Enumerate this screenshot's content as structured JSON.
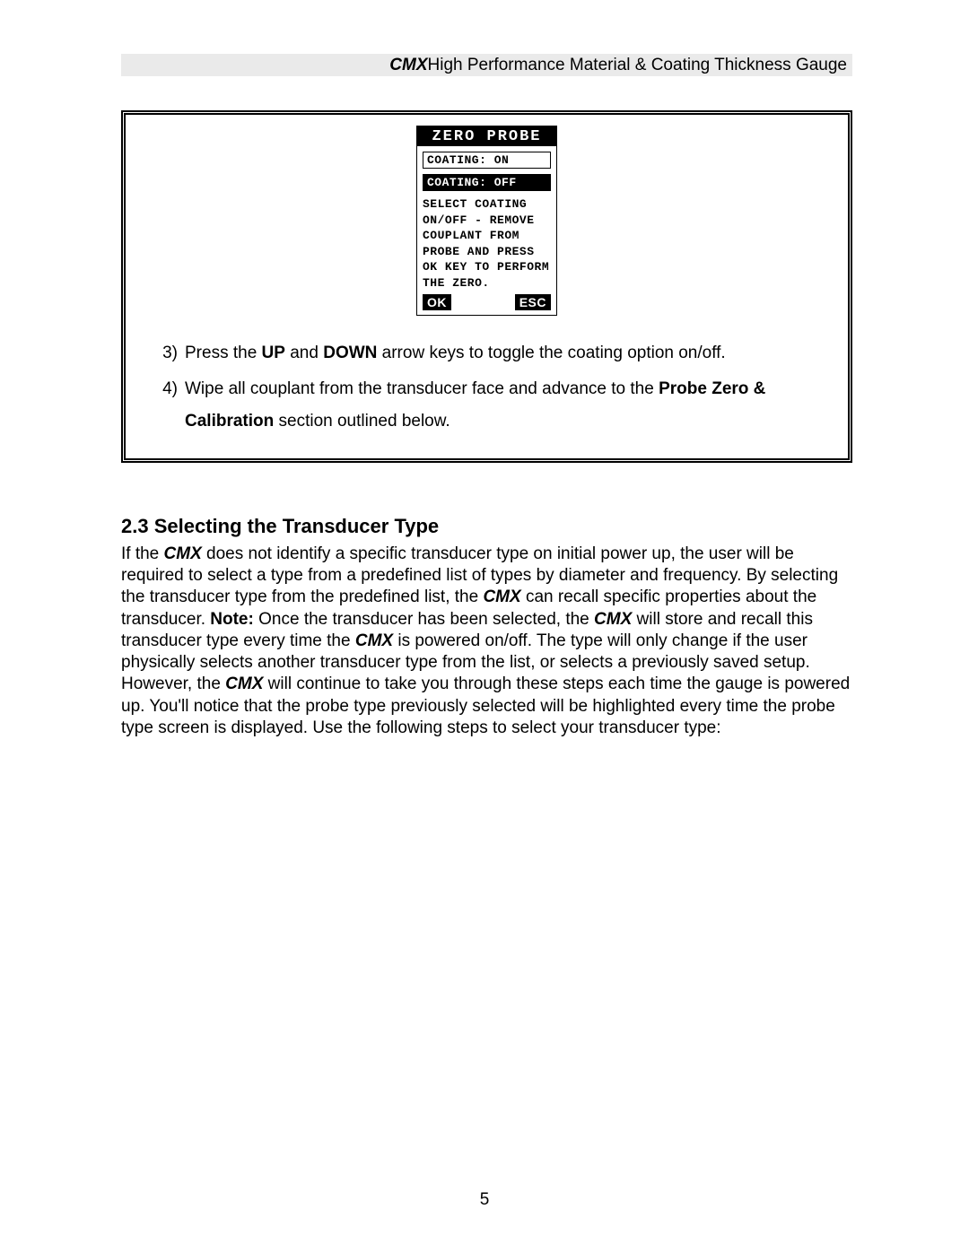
{
  "header": {
    "brand": "CMX",
    "tail": " High Performance Material & Coating  Thickness Gauge"
  },
  "lcd": {
    "title": "ZERO PROBE",
    "opt_on": "COATING:  ON",
    "opt_off": "COATING:  OFF",
    "msg_l1": "SELECT COATING",
    "msg_l2": "ON/OFF - REMOVE",
    "msg_l3": "COUPLANT FROM",
    "msg_l4": "PROBE AND PRESS",
    "msg_l5": "OK KEY TO PERFORM",
    "msg_l6": "THE ZERO.",
    "btn_ok": "OK",
    "btn_esc": "ESC"
  },
  "steps": {
    "s3num": "3)",
    "s3a": "Press the ",
    "s3b": "UP",
    "s3c": " and ",
    "s3d": "DOWN",
    "s3e": " arrow keys to toggle the coating option on/off.",
    "s4num": "4)",
    "s4a": "Wipe all couplant from the transducer face and advance to the ",
    "s4b": "Probe Zero & Calibration",
    "s4c": " section outlined below."
  },
  "section": {
    "heading": "2.3 Selecting the Transducer Type"
  },
  "para": {
    "t01": "If the ",
    "t02": "CMX",
    "t03": " does not identify a specific transducer type on initial power up, the user will be required to select a type from a predefined list of types by diameter and frequency.  By selecting the transducer type from the predefined list, the ",
    "t04": "CMX",
    "t05": " can recall specific properties about the transducer.  ",
    "t06": "Note:",
    "t07": "  Once the transducer has been selected, the ",
    "t08": "CMX",
    "t09": " will store and recall this transducer type every time the ",
    "t10": "CMX",
    "t11": " is powered on/off.  The type will only change if the user physically selects another transducer type from the list, or selects a previously saved setup.  However, the ",
    "t12": "CMX",
    "t13": " will continue to take you through these steps each time the gauge is powered up.  You'll notice that the probe type previously selected will be highlighted every time the probe type screen is displayed.  Use the following steps to select your transducer type:"
  },
  "page_number": "5"
}
